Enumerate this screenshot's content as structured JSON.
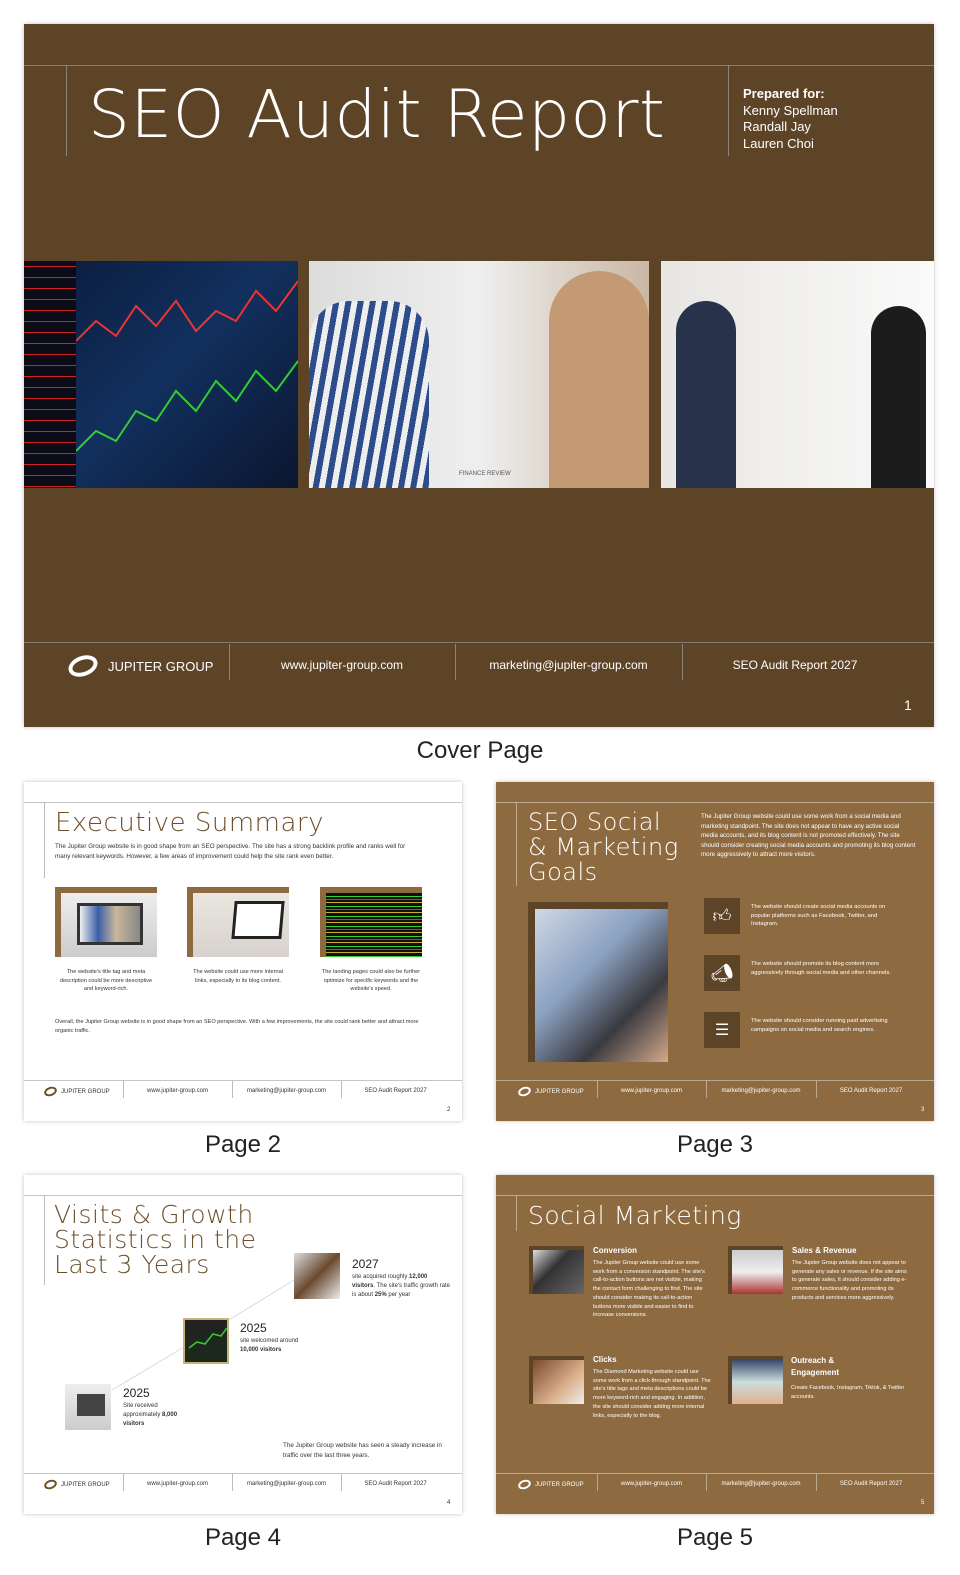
{
  "cover": {
    "title": "SEO Audit Report",
    "prepared_label": "Prepared for:",
    "recipients": [
      "Kenny Spellman",
      "Randall Jay",
      "Lauren Choi"
    ],
    "photo_caption": "FINANCE REVIEW",
    "page_number": "1",
    "caption": "Cover Page"
  },
  "footer": {
    "brand": "JUPITER GROUP",
    "website": "www.jupiter-group.com",
    "email": "marketing@jupiter-group.com",
    "report": "SEO Audit Report 2027"
  },
  "page2": {
    "caption": "Page 2",
    "title": "Executive Summary",
    "intro": "The Jupiter Group website is in good shape from an SEO perspective. The site has a strong backlink profile and ranks well for many relevant keywords. However, a few areas of improvement could help the site rank even better.",
    "items": [
      "The website's title tag and meta description could be more descriptive and keyword-rich.",
      "The website could use more internal links, especially to its blog content.",
      "The landing pages could also be further optimize for specific keywords and the website's speed."
    ],
    "outro": "Overall, the Jupiter Group website is in good shape from an SEO perspective. With a few improvements, the site could rank better and attract more organic traffic.",
    "page_number": "2"
  },
  "page3": {
    "caption": "Page 3",
    "title": "SEO Social & Marketing Goals",
    "intro": "The Jupiter Group website could use some work from a social media and marketing standpoint. The site does not appear to have any active social media accounts, and its blog content is not promoted effectively. The site should consider creating social media accounts and promoting its blog content more aggressively to attract more visitors.",
    "items": [
      {
        "icon": "thumbs-up-icon",
        "text": "The website should create social media accounts on popular platforms such as Facebook, Twitter, and Instagram."
      },
      {
        "icon": "megaphone-icon",
        "text": "The website should promote its blog content more aggressively through social media and other channels."
      },
      {
        "icon": "coins-icon",
        "text": "The website should consider running paid advertising campaigns on social media and search engines."
      }
    ],
    "page_number": "3"
  },
  "page4": {
    "caption": "Page 4",
    "title": "Visits & Growth Statistics in the Last 3 Years",
    "milestones": [
      {
        "year": "2027",
        "pre": "site acquired roughly ",
        "bold": "12,000 visitors",
        "post": ". The site's traffic growth rate is about ",
        "bold2": "25%",
        "post2": " per year"
      },
      {
        "year": "2025",
        "pre": "site welcomed around ",
        "bold": "10,000 visitors"
      },
      {
        "year": "2025",
        "pre": "Site received approximately ",
        "bold": "8,000 visitors"
      }
    ],
    "summary": "The Jupiter Group website has seen a steady increase in traffic over the last three years.",
    "page_number": "4"
  },
  "page5": {
    "caption": "Page 5",
    "title": "Social Marketing",
    "items": [
      {
        "heading": "Conversion",
        "text": "The Jupiter Group website could use some work from a conversion standpoint. The site's call-to-action buttons are not visible, making the contact form challenging to find. The site should consider making its call-to-action buttons more visible and easier to find to increase conversions."
      },
      {
        "heading": "Sales & Revenue",
        "text": "The Jupiter Group website does not appear to generate any sales or revenue. If the site aims to generate sales, it should consider adding e-commerce functionality and promoting its products and services more aggressively."
      },
      {
        "heading": "Clicks",
        "text": "The Diamond Marketing website could use some work from a click-through standpoint. The site's title tags and meta descriptions could be more keyword-rich and engaging. In addition, the site should consider adding more internal links, especially to the blog."
      },
      {
        "heading": "Outreach & Engagement",
        "text": "Create Facebook, Instagram, Tiktok, & Twitter accounts."
      }
    ],
    "page_number": "5"
  },
  "colors": {
    "cover_bg": "#5e4427",
    "tan_bg": "#8d6a40",
    "title_brown": "#6b4f2a"
  }
}
